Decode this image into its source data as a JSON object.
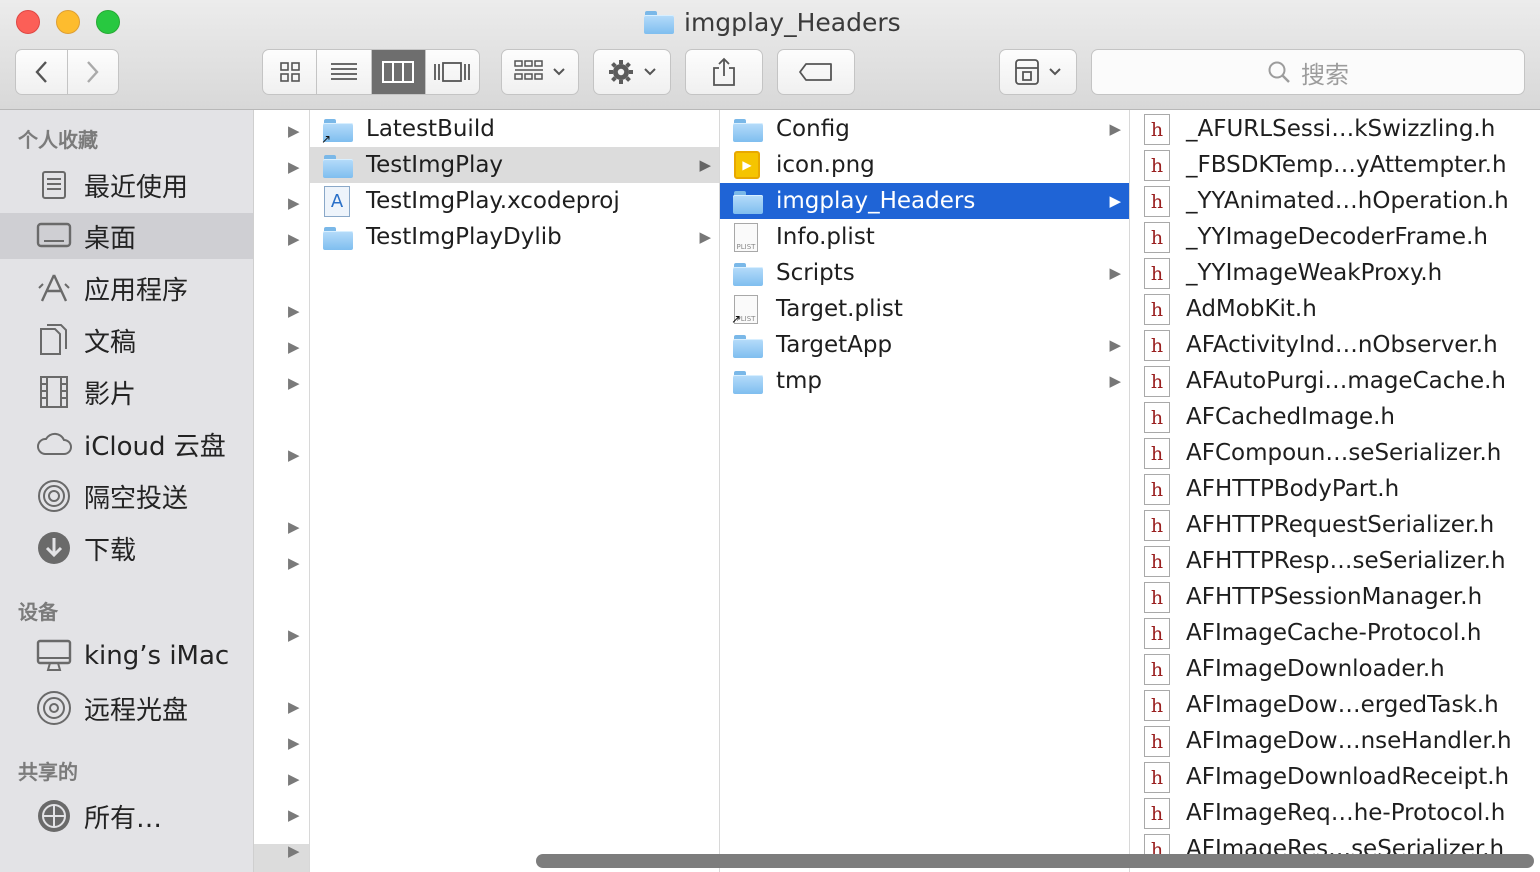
{
  "window": {
    "title": "imgplay_Headers",
    "search_placeholder": "搜索"
  },
  "toolbar": {
    "back_glyph": "‹",
    "forward_glyph": "›",
    "view_icons": "icon-view",
    "view_list": "list-view",
    "view_columns": "column-view",
    "view_coverflow": "coverflow-view",
    "active_view": "column-view"
  },
  "sidebar": {
    "favorites_header": "个人收藏",
    "favorites": [
      {
        "label": "最近使用",
        "icon": "recents-icon"
      },
      {
        "label": "桌面",
        "icon": "desktop-icon",
        "selected": true
      },
      {
        "label": "应用程序",
        "icon": "applications-icon"
      },
      {
        "label": "文稿",
        "icon": "documents-icon"
      },
      {
        "label": "影片",
        "icon": "movies-icon"
      },
      {
        "label": "iCloud 云盘",
        "icon": "icloud-icon"
      },
      {
        "label": "隔空投送",
        "icon": "airdrop-icon"
      },
      {
        "label": "下载",
        "icon": "downloads-icon"
      }
    ],
    "devices_header": "设备",
    "devices": [
      {
        "label": "king’s iMac",
        "icon": "imac-icon"
      },
      {
        "label": "远程光盘",
        "icon": "disc-icon"
      }
    ],
    "shared_header": "共享的",
    "shared": [
      {
        "label": "所有…",
        "icon": "network-icon"
      }
    ]
  },
  "column1": {
    "items": [
      {
        "label": "LatestBuild",
        "type": "folder",
        "alias": true,
        "chevron": false
      },
      {
        "label": "TestImgPlay",
        "type": "folder",
        "chevron": true,
        "selected": "grey"
      },
      {
        "label": "TestImgPlay.xcodeproj",
        "type": "xcodeproj",
        "chevron": false
      },
      {
        "label": "TestImgPlayDylib",
        "type": "folder",
        "chevron": true
      }
    ]
  },
  "column2": {
    "items": [
      {
        "label": "Config",
        "type": "folder",
        "chevron": true
      },
      {
        "label": "icon.png",
        "type": "png",
        "chevron": false
      },
      {
        "label": "imgplay_Headers",
        "type": "folder",
        "chevron": true,
        "selected": "blue"
      },
      {
        "label": "Info.plist",
        "type": "plist",
        "chevron": false
      },
      {
        "label": "Scripts",
        "type": "folder",
        "chevron": true
      },
      {
        "label": "Target.plist",
        "type": "plist",
        "alias": true,
        "chevron": false
      },
      {
        "label": "TargetApp",
        "type": "folder",
        "chevron": true
      },
      {
        "label": "tmp",
        "type": "folder",
        "chevron": true
      }
    ]
  },
  "column3": {
    "header_glyph": "h",
    "items": [
      "_AFURLSessi…kSwizzling.h",
      "_FBSDKTemp…yAttempter.h",
      "_YYAnimated…hOperation.h",
      "_YYImageDecoderFrame.h",
      "_YYImageWeakProxy.h",
      "AdMobKit.h",
      "AFActivityInd…nObserver.h",
      "AFAutoPurgi…mageCache.h",
      "AFCachedImage.h",
      "AFCompoun…seSerializer.h",
      "AFHTTPBodyPart.h",
      "AFHTTPRequestSerializer.h",
      "AFHTTPResp…seSerializer.h",
      "AFHTTPSessionManager.h",
      "AFImageCache-Protocol.h",
      "AFImageDownloader.h",
      "AFImageDow…ergedTask.h",
      "AFImageDow…nseHandler.h",
      "AFImageDownloadReceipt.h",
      "AFImageReq…he-Protocol.h",
      "AFImageRes…seSerializer.h"
    ]
  }
}
